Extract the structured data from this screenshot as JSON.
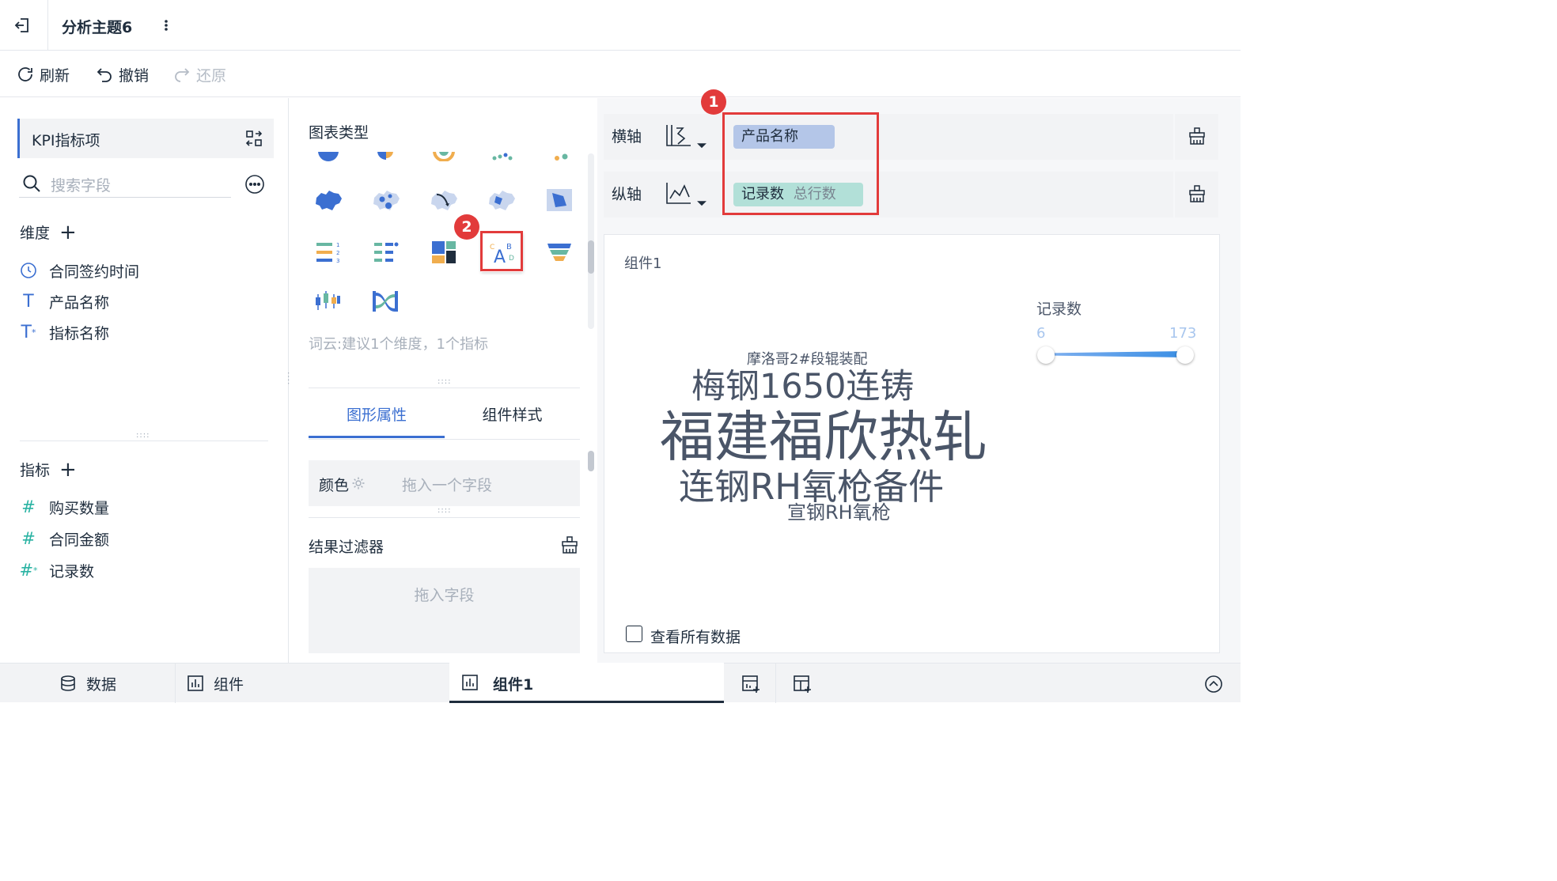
{
  "header": {
    "title": "分析主题6",
    "back_icon": "exit-icon",
    "more_icon": "more-vertical-icon"
  },
  "toolbar": {
    "refresh": "刷新",
    "undo": "撤销",
    "redo": "还原"
  },
  "left": {
    "kpi_label": "KPI指标项",
    "search_placeholder": "搜索字段",
    "dimension_title": "维度",
    "dimensions": [
      {
        "name": "合同签约时间",
        "icon": "clock-icon"
      },
      {
        "name": "产品名称",
        "icon": "text-type-icon"
      },
      {
        "name": "指标名称",
        "icon": "text-type-calc-icon"
      }
    ],
    "measure_title": "指标",
    "measures": [
      {
        "name": "购买数量",
        "icon": "number-type-icon"
      },
      {
        "name": "合同金额",
        "icon": "number-type-icon"
      },
      {
        "name": "记录数",
        "icon": "number-type-calc-icon"
      }
    ]
  },
  "middle": {
    "chart_type_title": "图表类型",
    "hint": "词云:建议1个维度，1个指标",
    "tabs": [
      "图形属性",
      "组件样式"
    ],
    "color_label": "颜色",
    "color_drop": "拖入一个字段",
    "filter_title": "结果过滤器",
    "filter_drop": "拖入字段"
  },
  "axes": {
    "x_label": "横轴",
    "x_field": "产品名称",
    "y_label": "纵轴",
    "y_field": "记录数",
    "y_field_agg": "总行数"
  },
  "annotations": {
    "badge1": "1",
    "badge2": "2"
  },
  "component": {
    "title": "组件1",
    "legend_title": "记录数",
    "legend_min": "6",
    "legend_max": "173",
    "show_all": "查看所有数据",
    "words": [
      "摩洛哥2#段辊装配",
      "梅钢1650连铸",
      "福建福欣热轧",
      "连钢RH氧枪备件",
      "宣钢RH氧枪"
    ]
  },
  "bottom": {
    "data_tab": "数据",
    "component_tab": "组件",
    "active_tab": "组件1"
  },
  "colors": {
    "accent": "#3b6fd1",
    "x_pill": "#b4c6e8",
    "y_pill": "#b2e0d8",
    "teal": "#2ab3a3",
    "badge": "#e23b3b"
  }
}
